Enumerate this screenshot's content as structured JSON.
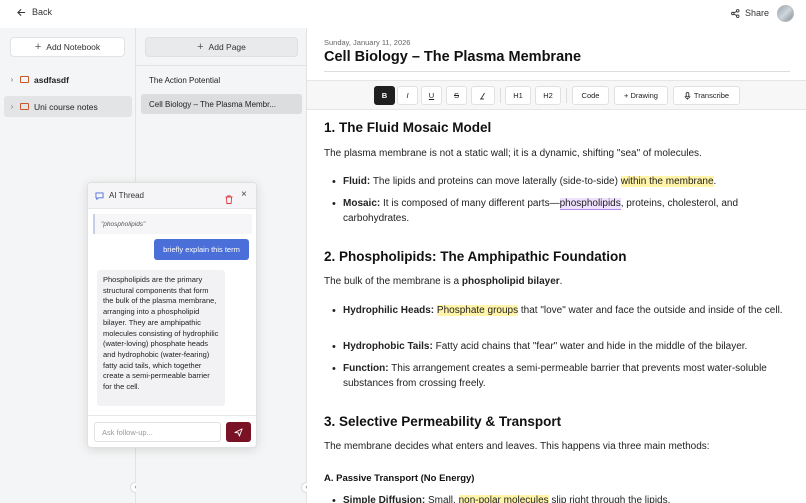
{
  "topbar": {
    "back_label": "Back",
    "share_label": "Share"
  },
  "notebooks": {
    "add_label": "Add Notebook",
    "items": [
      {
        "label": "asdfasdf"
      },
      {
        "label": "Uni course notes"
      }
    ]
  },
  "pages": {
    "add_label": "Add Page",
    "items": [
      {
        "label": "The Action Potential"
      },
      {
        "label": "Cell Biology – The Plasma Membr..."
      }
    ]
  },
  "doc": {
    "date": "Sunday, January 11, 2026",
    "title": "Cell Biology – The Plasma Membrane"
  },
  "toolbar": {
    "bold": "B",
    "italic": "I",
    "underline": "U",
    "strike": "S",
    "h1": "H1",
    "h2": "H2",
    "code": "Code",
    "drawing": "+ Drawing",
    "transcribe": "Transcribe"
  },
  "content": {
    "s1_heading": "1. The Fluid Mosaic Model",
    "s1_para": "The plasma membrane is not a static wall; it is a dynamic, shifting \"sea\" of molecules.",
    "s1_b1_label": "Fluid:",
    "s1_b1_text": " The lipids and proteins can move laterally (side-to-side) ",
    "s1_b1_hl": "within the membrane",
    "s1_b1_end": ".",
    "s1_b2_label": "Mosaic:",
    "s1_b2_text": " It is composed of many different parts—",
    "s1_b2_hl": "phospholipids",
    "s1_b2_end": ", proteins, cholesterol, and carbohydrates.",
    "s2_heading": "2. Phospholipids: The Amphipathic Foundation",
    "s2_para_a": "The bulk of the membrane is a ",
    "s2_para_b": "phospholipid bilayer",
    "s2_para_c": ".",
    "s2_b1_label": "Hydrophilic Heads:",
    "s2_b1_hl": "Phosphate groups",
    "s2_b1_text": " that \"love\" water and face the outside and inside of the cell.",
    "s2_b2_label": "Hydrophobic Tails:",
    "s2_b2_text": " Fatty acid chains that \"fear\" water and hide in the middle of the bilayer.",
    "s2_b3_label": "Function:",
    "s2_b3_text": " This arrangement creates a semi-permeable barrier that prevents most water-soluble substances from crossing freely.",
    "s3_heading": "3. Selective Permeability & Transport",
    "s3_para": "The membrane decides what enters and leaves. This happens via three main methods:",
    "s3_sub": "A. Passive Transport (No Energy)",
    "s3_b1_label": "Simple Diffusion:",
    "s3_b1_text": " Small, ",
    "s3_b1_hl": "non-polar molecules",
    "s3_b1_end": " slip right through the lipids."
  },
  "thread": {
    "title": "AI Thread",
    "quote": "\"phospholipids\"",
    "user_message": "briefly explain this term",
    "ai_message": "Phospholipids are the primary structural components that form the bulk of the plasma membrane, arranging into a phospholipid bilayer. They are amphipathic molecules consisting of hydrophilic (water-loving) phosphate heads and hydrophobic (water-fearing) fatty acid tails, which together create a semi-permeable barrier for the cell.",
    "input_placeholder": "Ask follow-up..."
  },
  "colors": {
    "accent_blue": "#4a6fd8",
    "send_button": "#7a1225",
    "highlight_yellow": "#fff4a8",
    "highlight_purple": "#efe2ff"
  }
}
